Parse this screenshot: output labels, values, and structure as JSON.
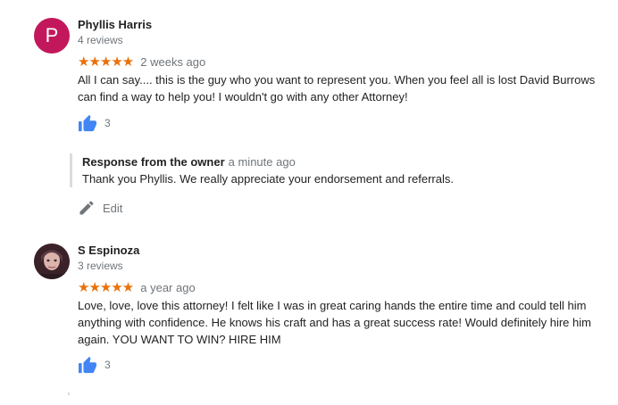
{
  "reviews": [
    {
      "avatar_letter": "P",
      "name": "Phyllis Harris",
      "review_count": "4 reviews",
      "stars": "★★★★★",
      "time": "2 weeks ago",
      "text": "All I can say.... this is the guy who you want to represent you. When you feel all is lost David Burrows can find a way to help you! I wouldn't go with any other Attorney!",
      "likes": "3",
      "owner_response": {
        "title": "Response from the owner",
        "time": "a minute ago",
        "text": "Thank you Phyllis. We really appreciate your endorsement and referrals."
      },
      "edit_label": "Edit"
    },
    {
      "name": "S Espinoza",
      "review_count": "3 reviews",
      "stars": "★★★★★",
      "time": "a year ago",
      "text": "Love, love, love this attorney! I felt like I was in great caring hands the entire time and could tell him anything with confidence.  He knows his craft and has a great success rate! Would definitely hire him again.  YOU WANT TO WIN? HIRE HIM",
      "likes": "3"
    }
  ],
  "colors": {
    "star": "#e8710a",
    "thumb": "#4285f4",
    "avatar_p": "#c2185b"
  },
  "icons": [
    "thumbs-up-icon",
    "pencil-icon"
  ]
}
